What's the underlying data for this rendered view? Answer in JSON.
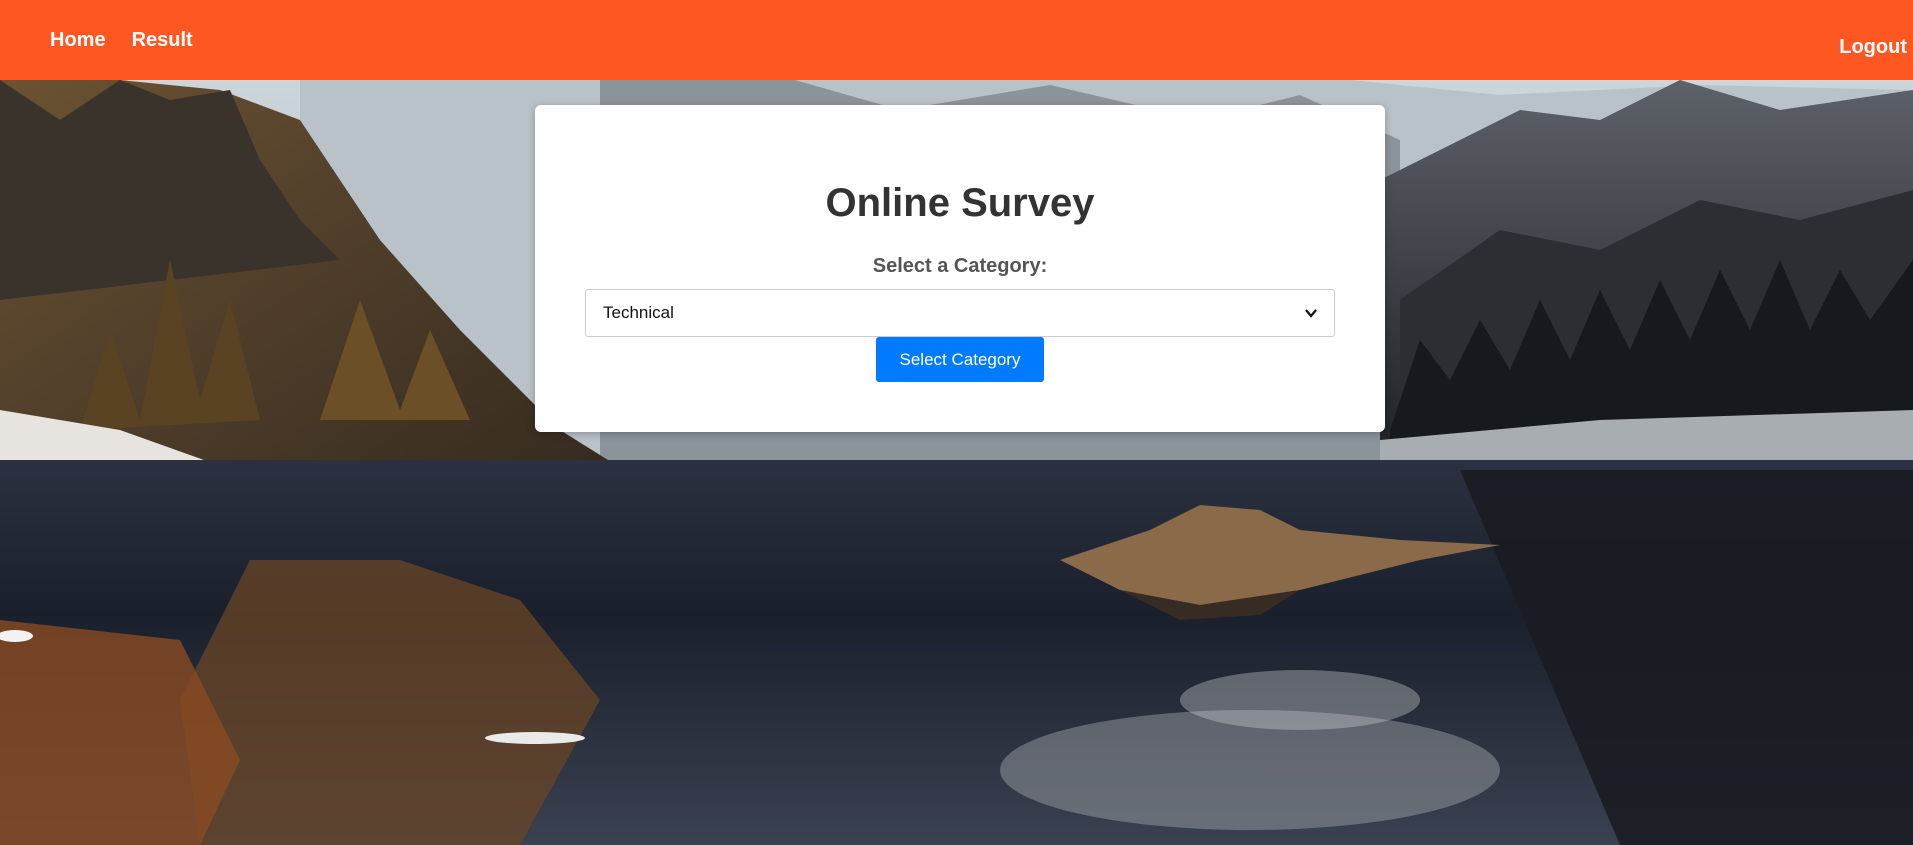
{
  "nav": {
    "home": "Home",
    "result": "Result",
    "logout": "Logout"
  },
  "survey": {
    "title": "Online Survey",
    "category_label": "Select a Category:",
    "category_value": "Technical",
    "submit_label": "Select Category"
  },
  "colors": {
    "navbar": "#ff5722",
    "button": "#007bff"
  }
}
